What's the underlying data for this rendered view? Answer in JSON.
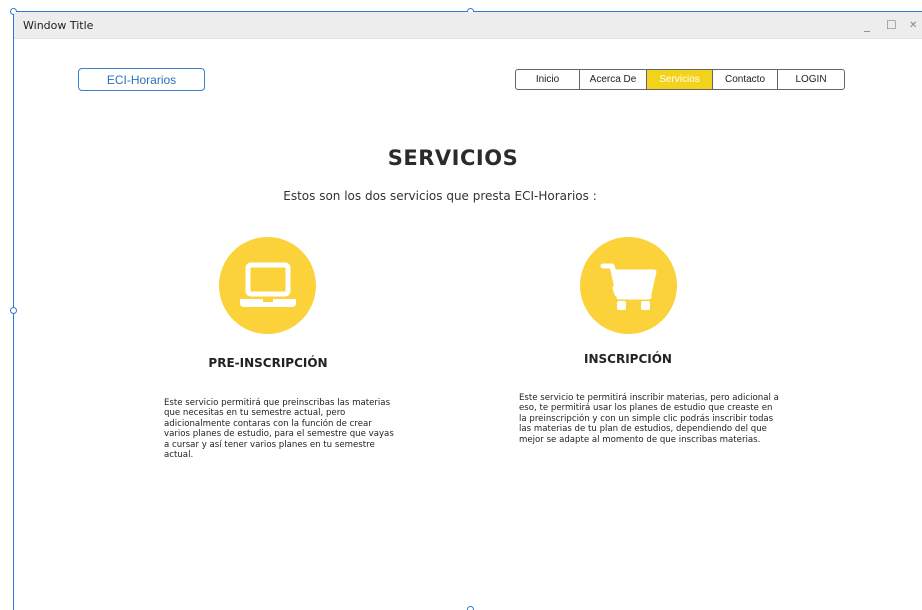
{
  "window": {
    "title": "Window Title",
    "minimize": "_",
    "maximize": "☐",
    "close": "✕"
  },
  "brand": {
    "label": "ECI-Horarios"
  },
  "nav": {
    "items": [
      {
        "label": "Inicio",
        "active": false
      },
      {
        "label": "Acerca De",
        "active": false
      },
      {
        "label": "Servicios",
        "active": true
      },
      {
        "label": "Contacto",
        "active": false
      },
      {
        "label": "LOGIN",
        "active": false
      }
    ],
    "active_color": "#f3d21b"
  },
  "page": {
    "heading": "SERVICIOS",
    "subtitle": "Estos son los dos servicios que presta ECI-Horarios :"
  },
  "services": [
    {
      "icon": "laptop-icon",
      "title": "PRE-INSCRIPCIÓN",
      "description": "Este servicio permitirá que preinscribas las materias que necesitas en tu semestre actual, pero adicionalmente contaras con la función de crear varios planes de estudio, para el semestre que vayas a cursar y así tener varios planes en tu semestre actual."
    },
    {
      "icon": "shopping-cart-icon",
      "title": "INSCRIPCIÓN",
      "description": "Este servicio te permitirá inscribir materias, pero adicional a eso, te permitirá usar los planes de estudio que creaste en la preinscripción y con un simple clic podrás inscribir todas las materias de tu plan de estudios, dependiendo del que mejor se adapte al momento de que inscribas materias."
    }
  ],
  "colors": {
    "accent": "#fbd23a",
    "brand_border": "#3b7fcf",
    "selection": "#2d7ad6"
  }
}
